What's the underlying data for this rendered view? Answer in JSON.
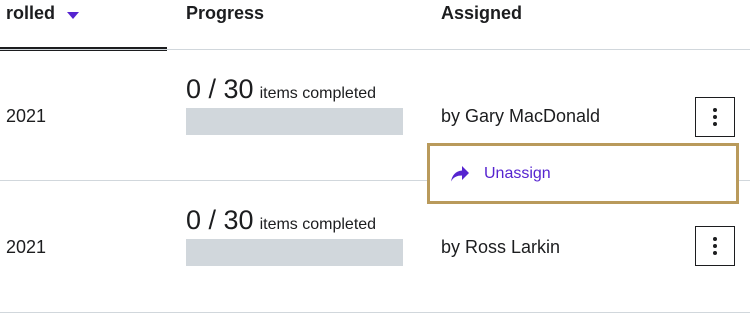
{
  "header": {
    "enrolled": "rolled",
    "progress": "Progress",
    "assigned": "Assigned"
  },
  "rows": [
    {
      "date": "2021",
      "progress_count": "0 / 30",
      "progress_suffix": "items completed",
      "progress_fraction": 0,
      "assigned": "by Gary MacDonald"
    },
    {
      "date": "2021",
      "progress_count": "0 / 30",
      "progress_suffix": "items completed",
      "progress_fraction": 0,
      "assigned": "by Ross Larkin"
    }
  ],
  "menu": {
    "items": [
      {
        "label": "Unassign",
        "icon": "share-arrow-icon"
      }
    ]
  },
  "colors": {
    "accent": "#5624d0",
    "menu_border": "#b99a5b",
    "track": "#d1d7dc"
  }
}
